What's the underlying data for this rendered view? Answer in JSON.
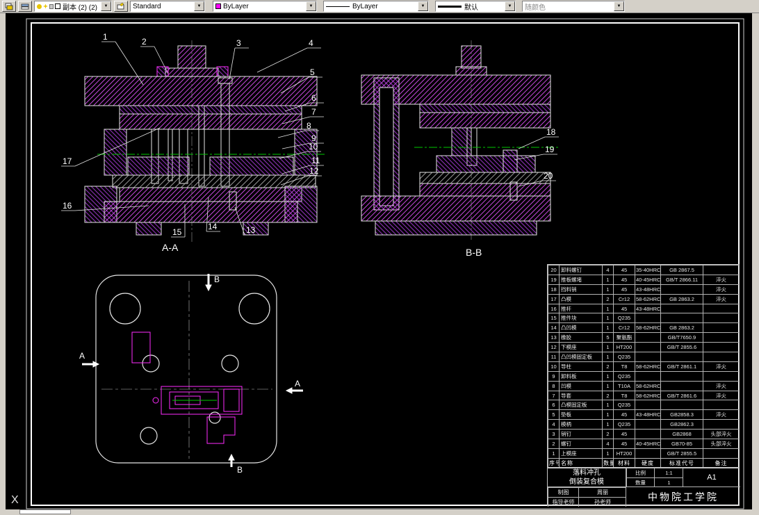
{
  "toolbar": {
    "layer_combo_value": "副本 (2) (2)",
    "text_style_combo_value": "Standard",
    "color_combo_value": "ByLayer",
    "linetype_combo_value": "ByLayer",
    "lineweight_combo_value": "默认",
    "plot_style_combo_value": "随颜色"
  },
  "views": {
    "section_aa_label": "A-A",
    "section_bb_label": "B-B",
    "arrow_a_label": "A",
    "arrow_b_label": "B"
  },
  "callouts": [
    "1",
    "2",
    "3",
    "4",
    "5",
    "6",
    "7",
    "8",
    "9",
    "10",
    "11",
    "12",
    "13",
    "14",
    "15",
    "16",
    "17",
    "18",
    "19",
    "20"
  ],
  "parts_table": {
    "headers": [
      "序号",
      "名称",
      "数量",
      "材料",
      "硬度",
      "标准代号",
      "备注"
    ],
    "rows": [
      [
        "20",
        "卸料螺钉",
        "4",
        "45",
        "35-40HRC",
        "GB 2867.5",
        ""
      ],
      [
        "19",
        "推板螺堵",
        "1",
        "45",
        "40-45HRC",
        "GB/T 2866.11",
        "淬火"
      ],
      [
        "18",
        "挡料销",
        "1",
        "45",
        "43-48HRC",
        "",
        "淬火"
      ],
      [
        "17",
        "凸模",
        "2",
        "Cr12",
        "58-62HRC",
        "GB 2863.2",
        "淬火"
      ],
      [
        "16",
        "推杆",
        "1",
        "45",
        "43-48HRC",
        "",
        ""
      ],
      [
        "15",
        "推件块",
        "1",
        "Q235",
        "",
        "",
        ""
      ],
      [
        "14",
        "凸凹模",
        "1",
        "Cr12",
        "58-62HRC",
        "GB 2863.2",
        ""
      ],
      [
        "13",
        "橡胶",
        "5",
        "聚氨酯",
        "",
        "GB/T7650.9",
        ""
      ],
      [
        "12",
        "下模座",
        "1",
        "HT200",
        "",
        "GB/T 2855.6",
        ""
      ],
      [
        "11",
        "凸凹模固定板",
        "1",
        "Q235",
        "",
        "",
        ""
      ],
      [
        "10",
        "导柱",
        "2",
        "T8",
        "58-62HRC",
        "GB/T 2861.1",
        "淬火"
      ],
      [
        "9",
        "卸料板",
        "1",
        "Q235",
        "",
        "",
        ""
      ],
      [
        "8",
        "凹模",
        "1",
        "T10A",
        "58-62HRC",
        "",
        "淬火"
      ],
      [
        "7",
        "导套",
        "2",
        "T8",
        "58-62HRC",
        "GB/T 2861.6",
        "淬火"
      ],
      [
        "6",
        "凸模固定板",
        "1",
        "Q235",
        "",
        "",
        ""
      ],
      [
        "5",
        "垫板",
        "1",
        "45",
        "43-48HRC",
        "GB2858.3",
        "淬火"
      ],
      [
        "4",
        "模柄",
        "1",
        "Q235",
        "",
        "GB2862.3",
        ""
      ],
      [
        "3",
        "销钉",
        "2",
        "45",
        "",
        "GB2868",
        "头部淬火"
      ],
      [
        "2",
        "螺钉",
        "4",
        "45",
        "40-45HRC",
        "GB70-85",
        "头部淬火"
      ],
      [
        "1",
        "上模座",
        "1",
        "HT200",
        "",
        "GB/T 2855.5",
        ""
      ]
    ]
  },
  "title_block": {
    "title_line1": "落料冲孔",
    "title_line2": "倒装复合模",
    "scale_label": "比例",
    "scale_value": "1:1",
    "qty_label": "数量",
    "qty_value": "1",
    "sheet_value": "A1",
    "drafter_label": "制图",
    "drafter_value": "周丽",
    "advisor_label": "指导老师",
    "advisor_value": "孙老师",
    "org_name": "中物院工学院"
  },
  "status": {
    "ucs_label": "X"
  },
  "colors": {
    "hatch_magenta": "#C84AE0",
    "detail_magenta": "#FF2BFF",
    "outline_white": "#E6E6E6",
    "centerline_green": "#00C800",
    "canvas_bg": "#000000"
  }
}
